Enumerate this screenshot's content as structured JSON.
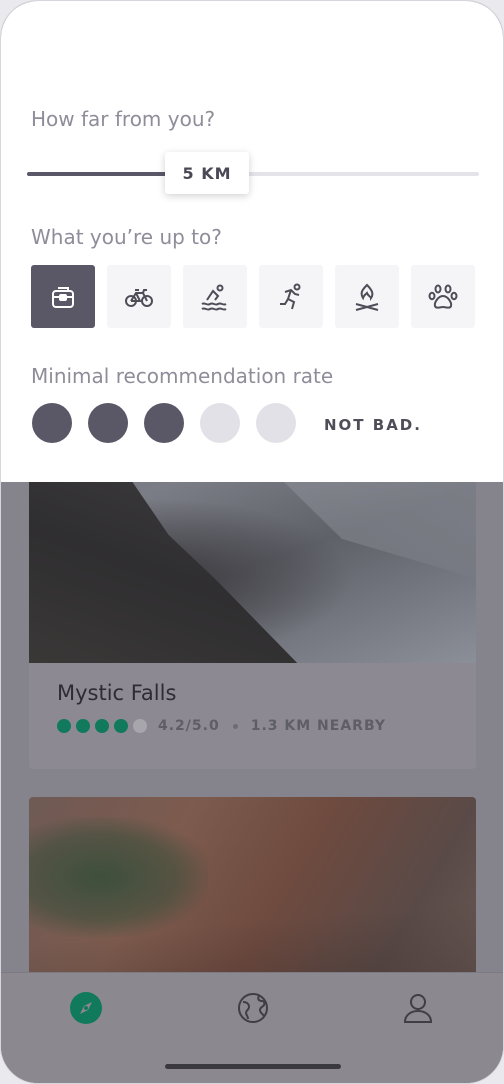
{
  "filters": {
    "distance": {
      "label": "How far from you?",
      "value_label": "5 KM",
      "value_fraction": 0.35
    },
    "activity": {
      "label": "What you’re up to?",
      "options": [
        {
          "name": "backpack-icon",
          "selected": true
        },
        {
          "name": "bicycle-icon",
          "selected": false
        },
        {
          "name": "swimming-icon",
          "selected": false
        },
        {
          "name": "running-icon",
          "selected": false
        },
        {
          "name": "campfire-icon",
          "selected": false
        },
        {
          "name": "paw-icon",
          "selected": false
        }
      ]
    },
    "rating": {
      "label": "Minimal recommendation rate",
      "value": 3,
      "max": 5,
      "value_label": "NOT BAD."
    }
  },
  "places": [
    {
      "title": "Mystic Falls",
      "stars": 4,
      "stars_max": 5,
      "rating_text": "4.2/5.0",
      "distance_text": "1.3 KM NEARBY"
    }
  ],
  "tabs": [
    {
      "name": "explore-icon",
      "active": true
    },
    {
      "name": "globe-icon",
      "active": false
    },
    {
      "name": "profile-icon",
      "active": false
    }
  ],
  "colors": {
    "accent": "#117a5c",
    "primary": "#5a5866",
    "inactive": "#e2e1e8"
  }
}
